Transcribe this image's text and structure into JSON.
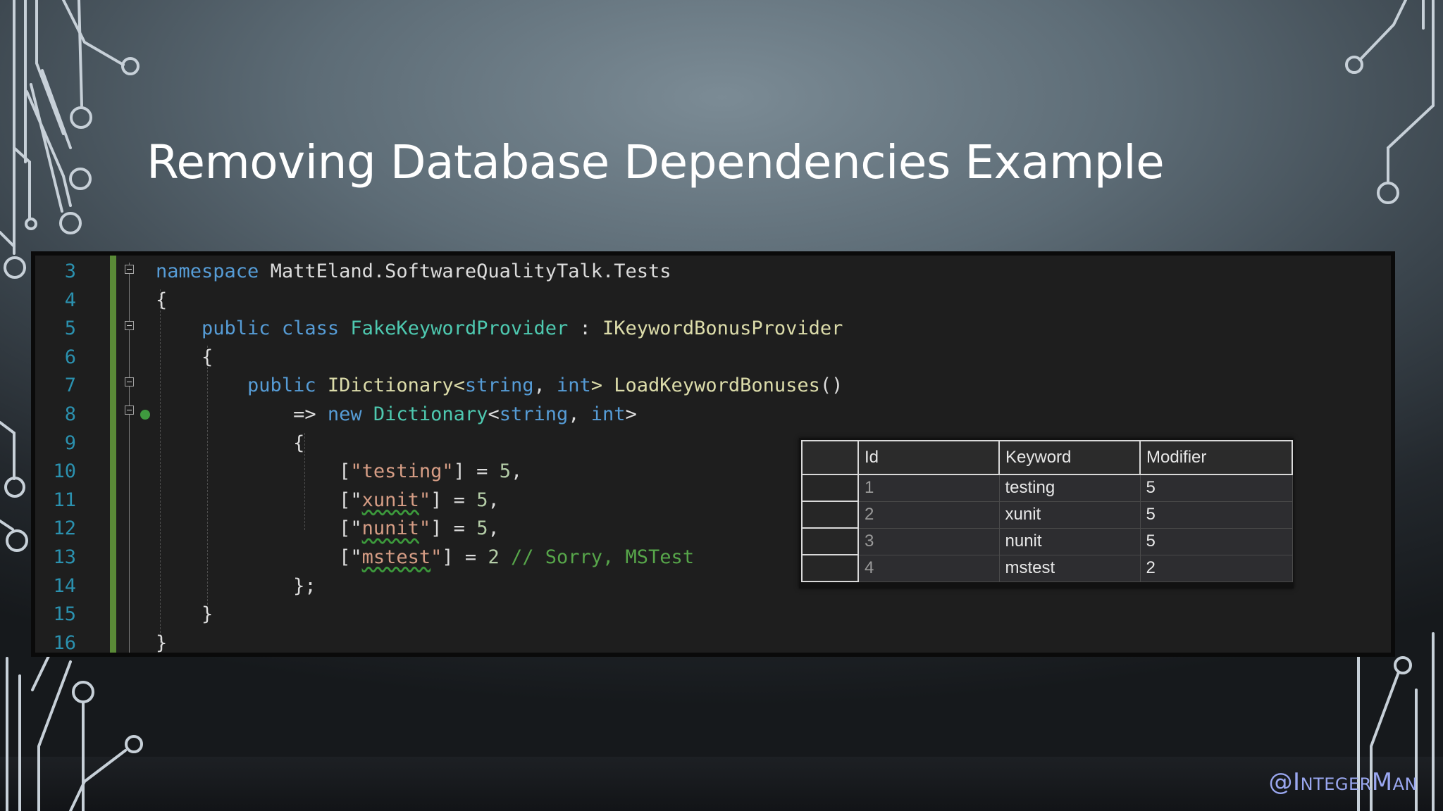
{
  "slide": {
    "title": "Removing Database Dependencies Example",
    "handle": "@IntegerMan"
  },
  "editor": {
    "lines": [
      {
        "number": "3",
        "tokens": [
          {
            "t": "namespace",
            "c": "kw"
          },
          {
            "t": " MattEland.SoftwareQualityTalk.Tests",
            "c": "pl"
          }
        ]
      },
      {
        "number": "4",
        "tokens": [
          {
            "t": "{",
            "c": "pl"
          }
        ]
      },
      {
        "number": "5",
        "tokens": [
          {
            "t": "    ",
            "c": "pl"
          },
          {
            "t": "public",
            "c": "kw"
          },
          {
            "t": " ",
            "c": "pl"
          },
          {
            "t": "class",
            "c": "kw"
          },
          {
            "t": " ",
            "c": "pl"
          },
          {
            "t": "FakeKeywordProvider",
            "c": "ty"
          },
          {
            "t": " : ",
            "c": "pl"
          },
          {
            "t": "IKeywordBonusProvider",
            "c": "fn"
          }
        ]
      },
      {
        "number": "6",
        "tokens": [
          {
            "t": "    {",
            "c": "pl"
          }
        ]
      },
      {
        "number": "7",
        "tokens": [
          {
            "t": "        ",
            "c": "pl"
          },
          {
            "t": "public",
            "c": "kw"
          },
          {
            "t": " IDictionary<",
            "c": "fn"
          },
          {
            "t": "string",
            "c": "kw"
          },
          {
            "t": ", ",
            "c": "pl"
          },
          {
            "t": "int",
            "c": "kw"
          },
          {
            "t": "> ",
            "c": "fn"
          },
          {
            "t": "LoadKeywordBonuses",
            "c": "fn"
          },
          {
            "t": "()",
            "c": "pl"
          }
        ]
      },
      {
        "number": "8",
        "tokens": [
          {
            "t": "            => ",
            "c": "pl"
          },
          {
            "t": "new",
            "c": "kw"
          },
          {
            "t": " ",
            "c": "pl"
          },
          {
            "t": "Dictionary",
            "c": "ty"
          },
          {
            "t": "<",
            "c": "pl"
          },
          {
            "t": "string",
            "c": "kw"
          },
          {
            "t": ", ",
            "c": "pl"
          },
          {
            "t": "int",
            "c": "kw"
          },
          {
            "t": ">",
            "c": "pl"
          }
        ]
      },
      {
        "number": "9",
        "tokens": [
          {
            "t": "            {",
            "c": "pl"
          }
        ]
      },
      {
        "number": "10",
        "tokens": [
          {
            "t": "                [",
            "c": "pl"
          },
          {
            "t": "\"testing\"",
            "c": "st"
          },
          {
            "t": "] = ",
            "c": "pl"
          },
          {
            "t": "5",
            "c": "nu"
          },
          {
            "t": ",",
            "c": "pl"
          }
        ]
      },
      {
        "number": "11",
        "tokens": [
          {
            "t": "                [\"",
            "c": "pl",
            "k": "st"
          },
          {
            "t": "xunit",
            "c": "st",
            "squig": true
          },
          {
            "t": "\"",
            "c": "st"
          },
          {
            "t": "] = ",
            "c": "pl"
          },
          {
            "t": "5",
            "c": "nu"
          },
          {
            "t": ",",
            "c": "pl"
          }
        ]
      },
      {
        "number": "12",
        "tokens": [
          {
            "t": "                [\"",
            "c": "pl",
            "k": "st"
          },
          {
            "t": "nunit",
            "c": "st",
            "squig": true
          },
          {
            "t": "\"",
            "c": "st"
          },
          {
            "t": "] = ",
            "c": "pl"
          },
          {
            "t": "5",
            "c": "nu"
          },
          {
            "t": ",",
            "c": "pl"
          }
        ]
      },
      {
        "number": "13",
        "tokens": [
          {
            "t": "                [\"",
            "c": "pl",
            "k": "st"
          },
          {
            "t": "mstest",
            "c": "st",
            "squig": true
          },
          {
            "t": "\"",
            "c": "st"
          },
          {
            "t": "] = ",
            "c": "pl"
          },
          {
            "t": "2",
            "c": "nu"
          },
          {
            "t": " ",
            "c": "pl"
          },
          {
            "t": "// Sorry, MSTest",
            "c": "cm"
          }
        ]
      },
      {
        "number": "14",
        "tokens": [
          {
            "t": "            };",
            "c": "pl"
          }
        ]
      },
      {
        "number": "15",
        "tokens": [
          {
            "t": "    }",
            "c": "pl"
          }
        ]
      },
      {
        "number": "16",
        "tokens": [
          {
            "t": "}",
            "c": "pl"
          }
        ]
      }
    ]
  },
  "results_grid": {
    "columns": [
      "Id",
      "Keyword",
      "Modifier"
    ],
    "rows": [
      [
        "1",
        "testing",
        "5"
      ],
      [
        "2",
        "xunit",
        "5"
      ],
      [
        "3",
        "nunit",
        "5"
      ],
      [
        "4",
        "mstest",
        "2"
      ]
    ]
  },
  "colors": {
    "keyword": "#569cd6",
    "type": "#4ec9b0",
    "method": "#dcdcaa",
    "string": "#d69d85",
    "number": "#b5cea8",
    "comment": "#57a64a",
    "line_number": "#2b91af",
    "change_bar": "#5a8a37",
    "handle": "#9aa7f0"
  }
}
